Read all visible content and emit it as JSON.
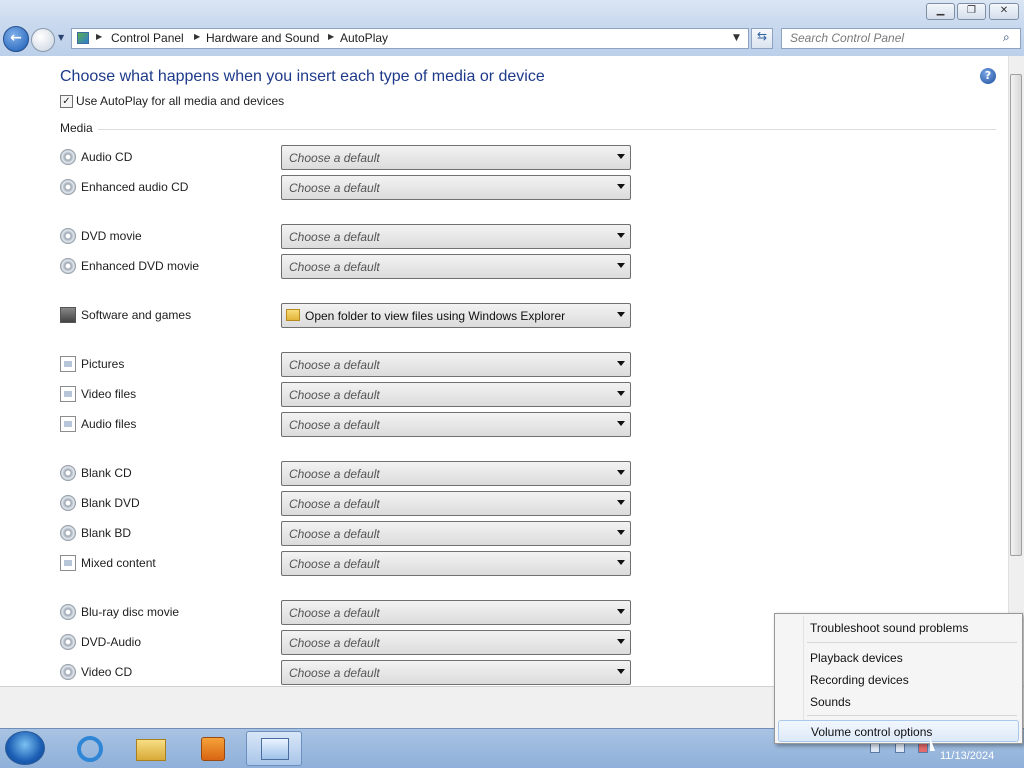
{
  "nav": {
    "breadcrumbs": [
      "Control Panel",
      "Hardware and Sound",
      "AutoPlay"
    ],
    "search_placeholder": "Search Control Panel"
  },
  "page": {
    "heading": "Choose what happens when you insert each type of media or device",
    "autoplay_checkbox_label": "Use AutoPlay for all media and devices",
    "autoplay_checked": true,
    "media_section_title": "Media",
    "rows": [
      {
        "label": "Audio CD",
        "icon": "audio-cd-icon",
        "value": "Choose a default"
      },
      {
        "label": "Enhanced audio CD",
        "icon": "enhanced-audio-cd-icon",
        "value": "Choose a default"
      },
      {
        "label": "DVD movie",
        "icon": "dvd-movie-icon",
        "value": "Choose a default"
      },
      {
        "label": "Enhanced DVD movie",
        "icon": "enhanced-dvd-movie-icon",
        "value": "Choose a default"
      },
      {
        "label": "Software and games",
        "icon": "software-games-icon",
        "value": "Open folder to view files using Windows Explorer"
      },
      {
        "label": "Pictures",
        "icon": "pictures-icon",
        "value": "Choose a default"
      },
      {
        "label": "Video files",
        "icon": "video-files-icon",
        "value": "Choose a default"
      },
      {
        "label": "Audio files",
        "icon": "audio-files-icon",
        "value": "Choose a default"
      },
      {
        "label": "Blank CD",
        "icon": "blank-cd-icon",
        "value": "Choose a default"
      },
      {
        "label": "Blank DVD",
        "icon": "blank-dvd-icon",
        "value": "Choose a default"
      },
      {
        "label": "Blank BD",
        "icon": "blank-bd-icon",
        "value": "Choose a default"
      },
      {
        "label": "Mixed content",
        "icon": "mixed-content-icon",
        "value": "Choose a default"
      },
      {
        "label": "Blu-ray disc movie",
        "icon": "bluray-icon",
        "value": "Choose a default"
      },
      {
        "label": "DVD-Audio",
        "icon": "dvd-audio-icon",
        "value": "Choose a default"
      },
      {
        "label": "Video CD",
        "icon": "video-cd-icon",
        "value": "Choose a default"
      }
    ]
  },
  "context_menu": {
    "items": [
      "Troubleshoot sound problems",
      "Playback devices",
      "Recording devices",
      "Sounds",
      "Volume control options"
    ],
    "hovered_item": "Volume control options"
  },
  "taskbar": {
    "clock_date": "11/13/2024",
    "pinned": [
      "internet-explorer-icon",
      "windows-explorer-icon",
      "media-player-icon",
      "control-panel-icon"
    ]
  },
  "colors": {
    "heading": "#1e3a8a",
    "taskbar": "#a8c3e3",
    "menu_hover": "#dde9f8"
  }
}
